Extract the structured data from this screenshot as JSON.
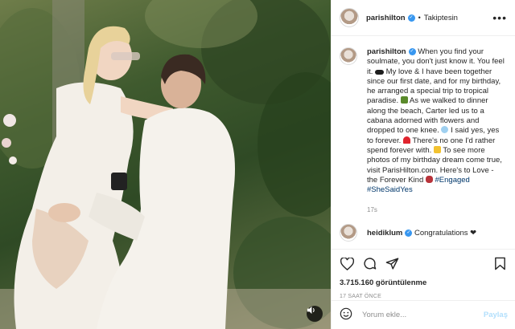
{
  "post": {
    "username": "parishilton",
    "follow_label": "Takiptesin",
    "more_label": "•••"
  },
  "caption": {
    "username": "parishilton",
    "text_1": "When you find your soulmate, you don't just know it. You feel it.",
    "text_2": "My love & I have been together since our first date, and for my birthday, he arranged a special trip to tropical paradise.",
    "text_3": "As we walked to dinner along the beach, Carter led us to a cabana adorned with flowers and dropped to one knee.",
    "text_4": "I said yes, yes to forever.",
    "text_5": "There's no one I'd rather spend forever with.",
    "text_6": "To see more photos of my birthday dream come true, visit ParisHilton.com. Here's to Love - the Forever Kind",
    "hashtag_1": "#Engaged",
    "hashtag_2": "#SheSaidYes",
    "time": "17s"
  },
  "comment": {
    "username": "heidiklum",
    "text": "Congratulations ❤"
  },
  "stats": {
    "views": "3.715.160 görüntülenme",
    "ago": "17 SAAT ÖNCE"
  },
  "composer": {
    "placeholder": "Yorum ekle...",
    "post_label": "Paylaş"
  },
  "icons": [
    "verified-badge-icon",
    "heart-icon",
    "comment-icon",
    "share-icon",
    "bookmark-icon",
    "smile-icon",
    "audio-icon"
  ]
}
